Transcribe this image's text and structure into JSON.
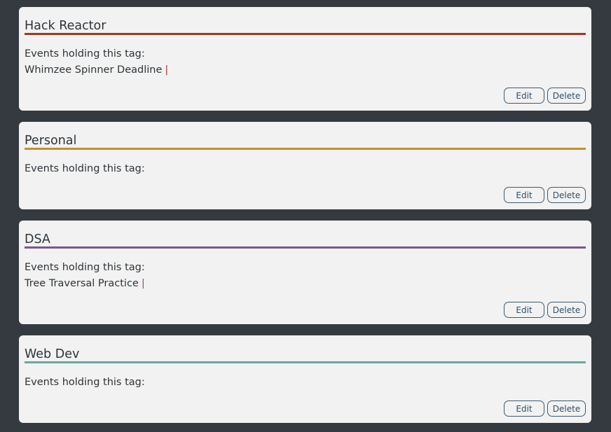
{
  "tags": [
    {
      "name": "Hack Reactor",
      "color": "#9b3a2a",
      "events_label": "Events holding this tag:",
      "events": [
        "Whimzee Spinner Deadline"
      ],
      "separator": "|",
      "edit_label": "Edit",
      "delete_label": "Delete"
    },
    {
      "name": "Personal",
      "color": "#c1902a",
      "events_label": "Events holding this tag:",
      "events": [],
      "separator": "",
      "edit_label": "Edit",
      "delete_label": "Delete"
    },
    {
      "name": "DSA",
      "color": "#7a568c",
      "events_label": "Events holding this tag:",
      "events": [
        "Tree Traversal Practice"
      ],
      "separator": "|",
      "edit_label": "Edit",
      "delete_label": "Delete"
    },
    {
      "name": "Web Dev",
      "color": "#6aa8a2",
      "events_label": "Events holding this tag:",
      "events": [],
      "separator": "",
      "edit_label": "Edit",
      "delete_label": "Delete"
    }
  ]
}
